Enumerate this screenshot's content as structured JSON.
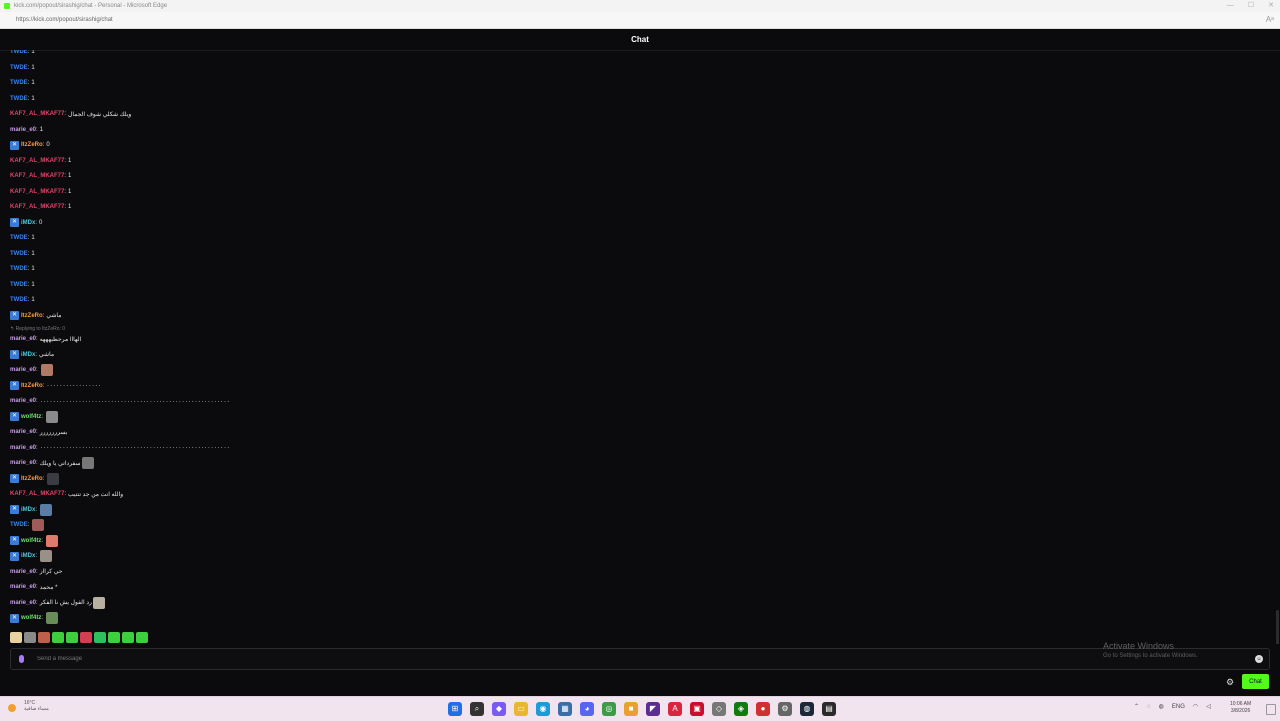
{
  "browser": {
    "title": "kick.com/popout/sirashig/chat - Personal - Microsoft Edge",
    "url": "https://kick.com/popout/sirashig/chat",
    "window_controls": [
      "—",
      "☐",
      "✕"
    ],
    "reader_icon": "reader-mode-icon"
  },
  "header": {
    "title": "Chat"
  },
  "messages": [
    {
      "user": "TWDE",
      "text": "1",
      "color": "#3b82f6",
      "badge": false
    },
    {
      "user": "TWDE",
      "text": "1",
      "color": "#3b82f6",
      "badge": false
    },
    {
      "user": "TWDE",
      "text": "1",
      "color": "#3b82f6",
      "badge": false
    },
    {
      "user": "TWDE",
      "text": "1",
      "color": "#3b82f6",
      "badge": false
    },
    {
      "user": "KAF7_AL_MKAF77",
      "text": "ويلك شكلي شوف الجمال",
      "color": "#e0446a",
      "badge": false
    },
    {
      "user": "marie_e0",
      "text": "1",
      "color": "#c79be8",
      "badge": false
    },
    {
      "user": "ItzZeRo",
      "text": "0",
      "color": "#ff9a3c",
      "badge": true
    },
    {
      "user": "KAF7_AL_MKAF77",
      "text": "1",
      "color": "#e0446a",
      "badge": false
    },
    {
      "user": "KAF7_AL_MKAF77",
      "text": "1",
      "color": "#e0446a",
      "badge": false
    },
    {
      "user": "KAF7_AL_MKAF77",
      "text": "1",
      "color": "#e0446a",
      "badge": false
    },
    {
      "user": "KAF7_AL_MKAF77",
      "text": "1",
      "color": "#e0446a",
      "badge": false
    },
    {
      "user": "iMDx",
      "text": "0",
      "color": "#4ec9d9",
      "badge": true
    },
    {
      "user": "TWDE",
      "text": "1",
      "color": "#3b82f6",
      "badge": false
    },
    {
      "user": "TWDE",
      "text": "1",
      "color": "#3b82f6",
      "badge": false
    },
    {
      "user": "TWDE",
      "text": "1",
      "color": "#3b82f6",
      "badge": false
    },
    {
      "user": "TWDE",
      "text": "1",
      "color": "#3b82f6",
      "badge": false
    },
    {
      "user": "TWDE",
      "text": "1",
      "color": "#3b82f6",
      "badge": false
    },
    {
      "user": "ItzZeRo",
      "text": "ماشي",
      "color": "#ff9a3c",
      "badge": true
    },
    {
      "user": "marie_e0",
      "text": "الهااا مرحطيهههه",
      "color": "#c79be8",
      "badge": false,
      "reply": "Replying to ItzZeRo: 0"
    },
    {
      "user": "iMDx",
      "text": "ماشي",
      "color": "#4ec9d9",
      "badge": true
    },
    {
      "user": "marie_e0",
      "text": "",
      "color": "#c79be8",
      "badge": false,
      "emote": "#b07a64"
    },
    {
      "user": "ItzZeRo",
      "text": "٠٠٠٠٠٠٠٠٠٠٠٠٠٠٠٠٠",
      "color": "#ff9a3c",
      "badge": true
    },
    {
      "user": "marie_e0",
      "text": "٠٠٠٠٠٠٠٠٠٠٠٠٠٠٠٠٠٠٠٠٠٠٠٠٠٠٠٠٠٠٠٠٠٠٠٠٠٠٠٠٠٠٠٠٠٠٠٠٠٠٠٠٠٠٠٠٠٠٠",
      "color": "#c79be8",
      "badge": false
    },
    {
      "user": "wolf4tz",
      "text": "",
      "color": "#6ee06e",
      "badge": true,
      "emote": "#8a8a8a"
    },
    {
      "user": "marie_e0",
      "text": "بسررررررر",
      "color": "#c79be8",
      "badge": false
    },
    {
      "user": "marie_e0",
      "text": "٠٠٠٠٠٠٠٠٠٠٠٠٠٠٠٠٠٠٠٠٠٠٠٠٠٠٠٠٠٠٠٠٠٠٠٠٠٠٠٠٠٠٠٠٠٠٠٠٠٠٠٠٠٠٠٠٠٠٠",
      "color": "#c79be8",
      "badge": false
    },
    {
      "user": "marie_e0",
      "text": "سفرداتي يا ويلك",
      "color": "#c79be8",
      "badge": false,
      "emote": "#777777"
    },
    {
      "user": "ItzZeRo",
      "text": "",
      "color": "#ff9a3c",
      "badge": true,
      "emote": "#3b3b44"
    },
    {
      "user": "KAF7_AL_MKAF77",
      "text": "والله انت من جد تنتيب",
      "color": "#e0446a",
      "badge": false
    },
    {
      "user": "iMDx",
      "text": "",
      "color": "#4ec9d9",
      "badge": true,
      "emote": "#5a7da8"
    },
    {
      "user": "TWDE",
      "text": "",
      "color": "#3b82f6",
      "badge": false,
      "emote": "#a05a5a"
    },
    {
      "user": "wolf4tz",
      "text": "",
      "color": "#6ee06e",
      "badge": true,
      "emote": "#e07a6a"
    },
    {
      "user": "iMDx",
      "text": "",
      "color": "#4ec9d9",
      "badge": true,
      "emote": "#9a9088"
    },
    {
      "user": "marie_e0",
      "text": "حي كرااز",
      "color": "#c79be8",
      "badge": false
    },
    {
      "user": "marie_e0",
      "text": "محمد *",
      "color": "#c79be8",
      "badge": false
    },
    {
      "user": "marie_e0",
      "text": "رد الفول يش نا الفكر",
      "color": "#c79be8",
      "badge": false,
      "emote": "#b8b0a0"
    },
    {
      "user": "wolf4tz",
      "text": "",
      "color": "#6ee06e",
      "badge": true,
      "emote": "#6a8a5a"
    }
  ],
  "emote_bar": [
    "#e8d2a0",
    "#8a8a8a",
    "#c0604a",
    "#3ecf3e",
    "#3ecf3e",
    "#d04050",
    "#2fbf5f",
    "#3ecf3e",
    "#3ecf3e",
    "#3ecf3e"
  ],
  "input": {
    "placeholder": "Send a message"
  },
  "watermark": {
    "line1": "Activate Windows",
    "line2": "Go to Settings to activate Windows."
  },
  "send_button": "Chat",
  "taskbar": {
    "weather_temp": "16°C",
    "weather_desc": "مساء صافية",
    "icons": [
      {
        "name": "start-icon",
        "color": "#1f6fe5",
        "glyph": "⊞"
      },
      {
        "name": "search-icon",
        "color": "#333333",
        "glyph": "⌕"
      },
      {
        "name": "copilot-icon",
        "color": "#7a5af5",
        "glyph": "◆"
      },
      {
        "name": "file-explorer-icon",
        "color": "#e8b730",
        "glyph": "▭"
      },
      {
        "name": "edge-icon",
        "color": "#1c9bd8",
        "glyph": "◉"
      },
      {
        "name": "store-icon",
        "color": "#3a6ea8",
        "glyph": "▦"
      },
      {
        "name": "discord-icon",
        "color": "#5865f2",
        "glyph": "◕"
      },
      {
        "name": "chrome-icon",
        "color": "#3f9b48",
        "glyph": "◎"
      },
      {
        "name": "app-icon",
        "color": "#e8a030",
        "glyph": "■"
      },
      {
        "name": "vs-icon",
        "color": "#5c2d91",
        "glyph": "◤"
      },
      {
        "name": "acrobat-icon",
        "color": "#d7263d",
        "glyph": "A"
      },
      {
        "name": "game-icon",
        "color": "#c8102e",
        "glyph": "▣"
      },
      {
        "name": "network-icon",
        "color": "#777777",
        "glyph": "◇"
      },
      {
        "name": "xbox-icon",
        "color": "#107c10",
        "glyph": "◈"
      },
      {
        "name": "record-icon",
        "color": "#d03030",
        "glyph": "●"
      },
      {
        "name": "settings-icon",
        "color": "#666666",
        "glyph": "⚙"
      },
      {
        "name": "steam-icon",
        "color": "#1b2838",
        "glyph": "◍"
      },
      {
        "name": "terminal-icon",
        "color": "#2a2a2a",
        "glyph": "▤"
      }
    ],
    "lang": "ENG",
    "time": "10:06 AM",
    "date": "3/8/2026"
  }
}
